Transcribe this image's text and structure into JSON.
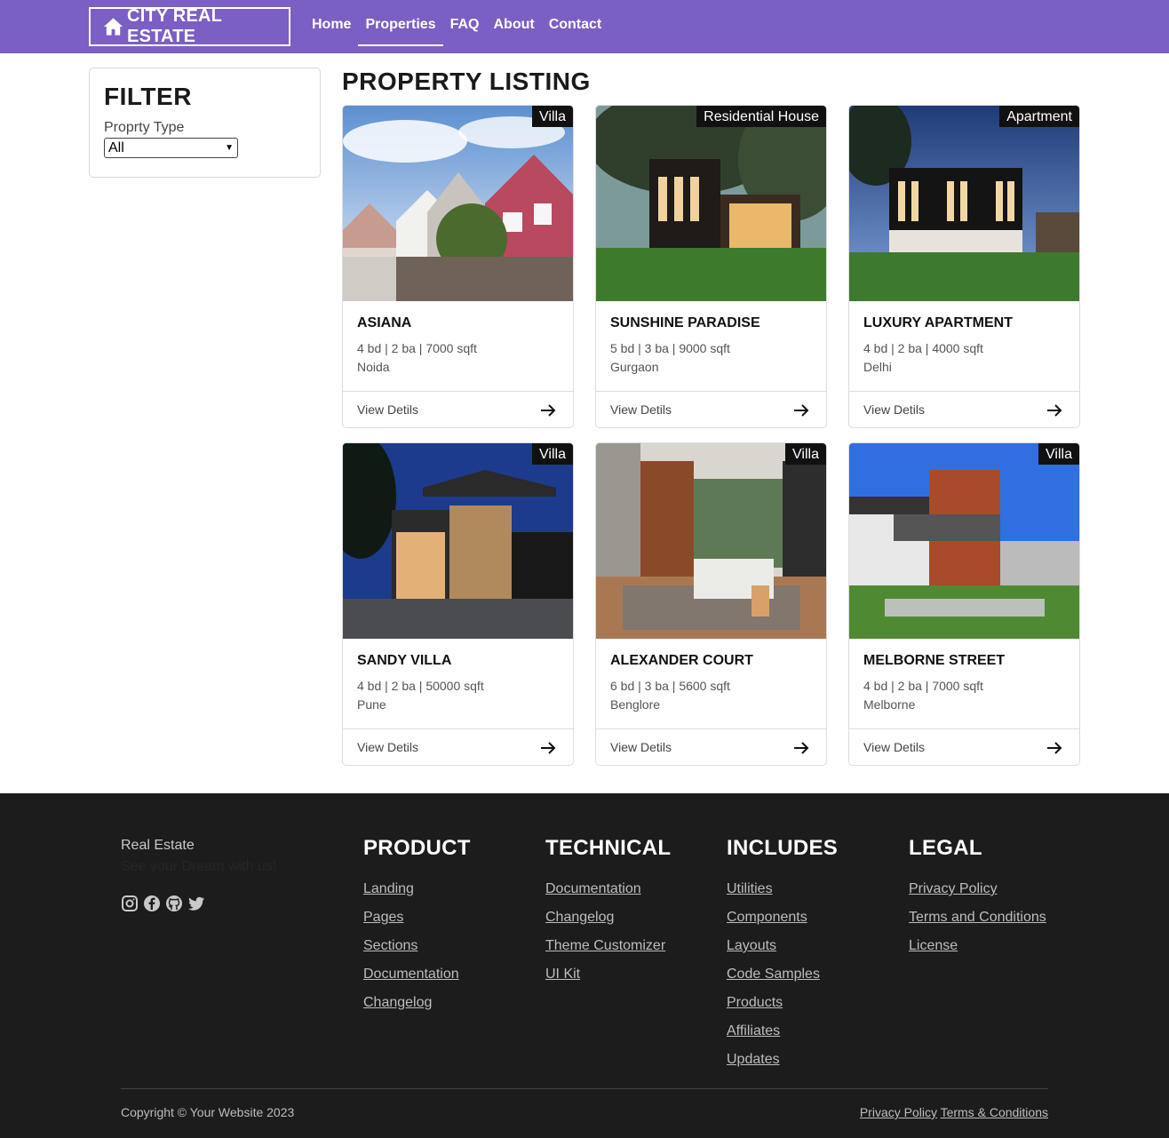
{
  "nav": {
    "brand": "CITY REAL ESTATE",
    "links": [
      "Home",
      "Properties",
      "FAQ",
      "About",
      "Contact"
    ],
    "active": "Properties"
  },
  "filter": {
    "title": "FILTER",
    "label": "Proprty Type",
    "selected": "All"
  },
  "listing": {
    "title": "PROPERTY LISTING",
    "view_label": "View Detils",
    "cards": [
      {
        "tag": "Villa",
        "name": "ASIANA",
        "meta": "4 bd | 2 ba | 7000 sqft",
        "location": "Noida"
      },
      {
        "tag": "Residential House",
        "name": "SUNSHINE PARADISE",
        "meta": "5 bd | 3 ba | 9000 sqft",
        "location": "Gurgaon"
      },
      {
        "tag": "Apartment",
        "name": "LUXURY APARTMENT",
        "meta": "4 bd | 2 ba | 4000 sqft",
        "location": "Delhi"
      },
      {
        "tag": "Villa",
        "name": "SANDY VILLA",
        "meta": "4 bd | 2 ba | 50000 sqft",
        "location": "Pune"
      },
      {
        "tag": "Villa",
        "name": "ALEXANDER COURT",
        "meta": "6 bd | 3 ba | 5600 sqft",
        "location": "Benglore"
      },
      {
        "tag": "Villa",
        "name": "MELBORNE STREET",
        "meta": "4 bd | 2 ba | 7000 sqft",
        "location": "Melborne"
      }
    ]
  },
  "footer": {
    "brand": "Real Estate",
    "tagline": "See your Dream with us!",
    "social_icons": [
      "instagram-icon",
      "facebook-icon",
      "github-icon",
      "twitter-icon"
    ],
    "columns": [
      {
        "title": "PRODUCT",
        "links": [
          "Landing",
          "Pages",
          "Sections",
          "Documentation",
          "Changelog"
        ]
      },
      {
        "title": "TECHNICAL",
        "links": [
          "Documentation",
          "Changelog",
          "Theme Customizer",
          "UI Kit"
        ]
      },
      {
        "title": "INCLUDES",
        "links": [
          "Utilities",
          "Components",
          "Layouts",
          "Code Samples",
          "Products",
          "Affiliates",
          "Updates"
        ]
      },
      {
        "title": "LEGAL",
        "links": [
          "Privacy Policy",
          "Terms and Conditions",
          "License"
        ]
      }
    ],
    "copyright": "Copyright © Your Website 2023",
    "bottom_links": [
      "Privacy Policy",
      "Terms & Conditions"
    ]
  },
  "colors": {
    "nav_bg": "#7a5fc4",
    "footer_bg": "#1c1c1c",
    "tag_bg": "#111111"
  }
}
